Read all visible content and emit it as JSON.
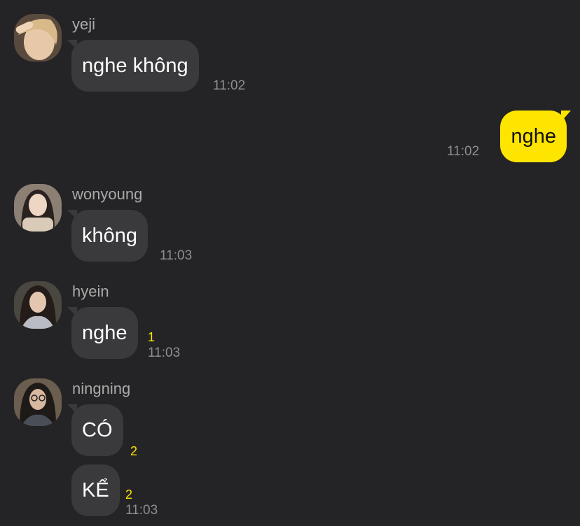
{
  "colors": {
    "background": "#242426",
    "bubble_incoming": "#3a3a3c",
    "bubble_outgoing": "#fee500",
    "unread_count": "#fee500",
    "timestamp": "#8e8e93",
    "sender_name": "#aaaaaa"
  },
  "messages": [
    {
      "sender": "yeji",
      "avatar": "avatar-yeji",
      "text": "nghe không",
      "time": "11:02"
    },
    {
      "sender": "me",
      "text": "nghe",
      "time": "11:02"
    },
    {
      "sender": "wonyoung",
      "avatar": "avatar-wonyoung",
      "text": "không",
      "time": "11:03"
    },
    {
      "sender": "hyein",
      "avatar": "avatar-hyein",
      "text": "nghe",
      "unread": "1",
      "time": "11:03"
    },
    {
      "sender": "ningning",
      "avatar": "avatar-ningning",
      "text": "CÓ",
      "unread": "2"
    },
    {
      "sender": "ningning",
      "text": "KỂ",
      "unread": "2",
      "time": "11:03"
    }
  ]
}
